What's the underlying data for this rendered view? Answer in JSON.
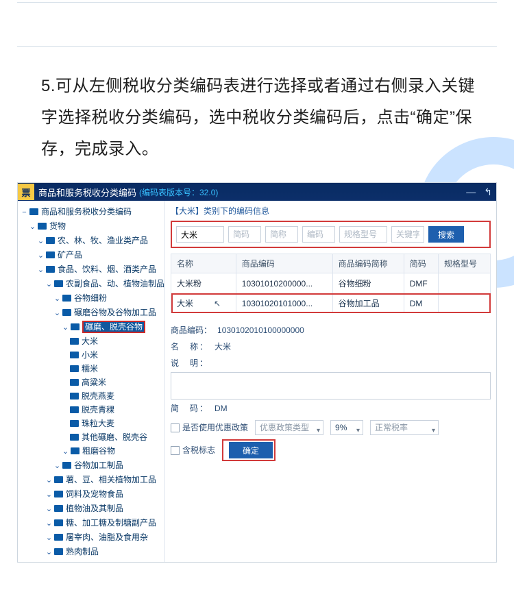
{
  "instruction": "5.可从左侧税收分类编码表进行选择或者通过右侧录入关键字选择税收分类编码，选中税收分类编码后，点击“确定”保存，完成录入。",
  "titlebar": {
    "logo": "票",
    "title": "商品和服务税收分类编码",
    "version": "(编码表版本号：32.0)",
    "min": "—",
    "back": "↰"
  },
  "tree": {
    "root": "商品和服务税收分类编码",
    "huowu": "货物",
    "nonglin": "农、林、牧、渔业类产品",
    "kuangchanpin": "矿产品",
    "shipin": "食品、饮料、烟、酒类产品",
    "nongfu": "农副食品、动、植物油制品",
    "guowuxifen": "谷物细粉",
    "nianmo": "碾磨谷物及谷物加工品",
    "nianmo2": "碾磨、脱壳谷物",
    "dami": "大米",
    "xiaomi": "小米",
    "nuomi": "糯米",
    "gaoliangmi": "高粱米",
    "tuokeyanmai": "脱壳燕麦",
    "tuokeqingke": "脱壳青稞",
    "zhulidamai": "珠粒大麦",
    "qitamianmo": "其他碾磨、脱壳谷",
    "cumoguwu": "粗磨谷物",
    "guwujiagong": "谷物加工制品",
    "shudou": "薯、豆、相关植物加工品",
    "siliao": "饲料及宠物食品",
    "zhiwuyou": "植物油及其制品",
    "tangjiagong": "糖、加工糖及制糖副产品",
    "tuzairouyouzhi": "屠宰肉、油脂及食用杂",
    "shuroupin": "熟肉制品"
  },
  "main": {
    "section_label": "【大米】类别下的编码信息",
    "search": {
      "name_value": "大米",
      "ph_jm": "简码",
      "ph_jc": "简称",
      "ph_bm": "编码",
      "ph_ggxh": "规格型号",
      "ph_gjz": "关键字",
      "btn": "搜索"
    },
    "table": {
      "headers": {
        "c1": "名称",
        "c2": "商品编码",
        "c3": "商品编码简称",
        "c4": "简码",
        "c5": "规格型号"
      },
      "rows": [
        {
          "c1": "大米粉",
          "c2": "10301010200000...",
          "c3": "谷物细粉",
          "c4": "DMF",
          "c5": ""
        },
        {
          "c1": "大米",
          "c2": "10301020101000...",
          "c3": "谷物加工品",
          "c4": "DM",
          "c5": ""
        }
      ]
    },
    "detail": {
      "spbm_label": "商品编码：",
      "spbm_value": "1030102010100000000",
      "mc_label": "名　称：",
      "mc_value": "大米",
      "sm_label": "说　明：",
      "jm_label": "简　码：",
      "jm_value": "DM",
      "chk_youhui": "是否使用优惠政策",
      "sel_youhui_ph": "优惠政策类型",
      "sel_rate": "9%",
      "sel_zcsl": "正常税率",
      "chk_hanshui": "含税标志",
      "btn_ok": "确定"
    }
  }
}
